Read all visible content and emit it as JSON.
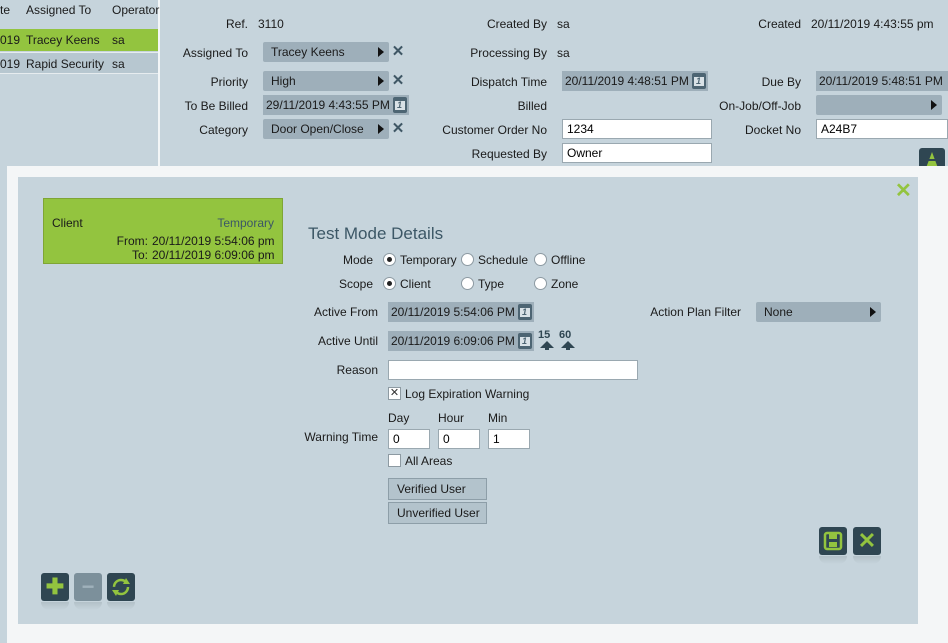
{
  "list": {
    "headers": [
      "te",
      "Assigned To",
      "Operator"
    ],
    "rows": [
      {
        "date": "019",
        "assigned": "Tracey Keens",
        "operator": "sa",
        "selected": true
      },
      {
        "date": "019",
        "assigned": "Rapid Security",
        "operator": "sa",
        "selected": false
      }
    ]
  },
  "form": {
    "ref_label": "Ref.",
    "ref_value": "3110",
    "created_by_label": "Created By",
    "created_by_value": "sa",
    "created_label": "Created",
    "created_value": "20/11/2019 4:43:55 pm",
    "assigned_to_label": "Assigned To",
    "assigned_to_value": "Tracey Keens",
    "processing_by_label": "Processing By",
    "processing_by_value": "sa",
    "priority_label": "Priority",
    "priority_value": "High",
    "dispatch_time_label": "Dispatch Time",
    "dispatch_time_value": "20/11/2019 4:48:51 PM",
    "due_by_label": "Due By",
    "due_by_value": "20/11/2019 5:48:51 PM",
    "to_be_billed_label": "To Be Billed",
    "to_be_billed_value": "29/11/2019 4:43:55 PM",
    "billed_label": "Billed",
    "on_job_label": "On-Job/Off-Job",
    "on_job_value": "",
    "category_label": "Category",
    "category_value": "Door Open/Close",
    "customer_order_label": "Customer Order No",
    "customer_order_value": "1234",
    "docket_label": "Docket No",
    "docket_value": "A24B7",
    "requested_by_label": "Requested By",
    "requested_by_value": "Owner"
  },
  "modal": {
    "card": {
      "title": "Client",
      "tag": "Temporary",
      "from_label": "From:",
      "from_value": "20/11/2019 5:54:06 pm",
      "to_label": "To:",
      "to_value": "20/11/2019 6:09:06 pm"
    },
    "title": "Test Mode Details",
    "mode_label": "Mode",
    "mode_options": [
      "Temporary",
      "Schedule",
      "Offline"
    ],
    "mode_selected": "Temporary",
    "scope_label": "Scope",
    "scope_options": [
      "Client",
      "Type",
      "Zone"
    ],
    "scope_selected": "Client",
    "active_from_label": "Active From",
    "active_from_value": "20/11/2019 5:54:06 PM",
    "active_until_label": "Active Until",
    "active_until_value": "20/11/2019 6:09:06 PM",
    "quick_15": "15",
    "quick_60": "60",
    "action_plan_label": "Action Plan Filter",
    "action_plan_value": "None",
    "reason_label": "Reason",
    "reason_value": "",
    "log_expiration_label": "Log Expiration Warning",
    "log_expiration_checked": true,
    "warning_time_label": "Warning Time",
    "day_label": "Day",
    "day_value": "0",
    "hour_label": "Hour",
    "hour_value": "0",
    "min_label": "Min",
    "min_value": "1",
    "all_areas_label": "All Areas",
    "all_areas_checked": false,
    "verified_user_label": "Verified User",
    "unverified_user_label": "Unverified User"
  },
  "colors": {
    "accent_green": "#93c43f",
    "panel": "#c6d4dc",
    "dark": "#2f4652",
    "widget": "#9eafba"
  }
}
